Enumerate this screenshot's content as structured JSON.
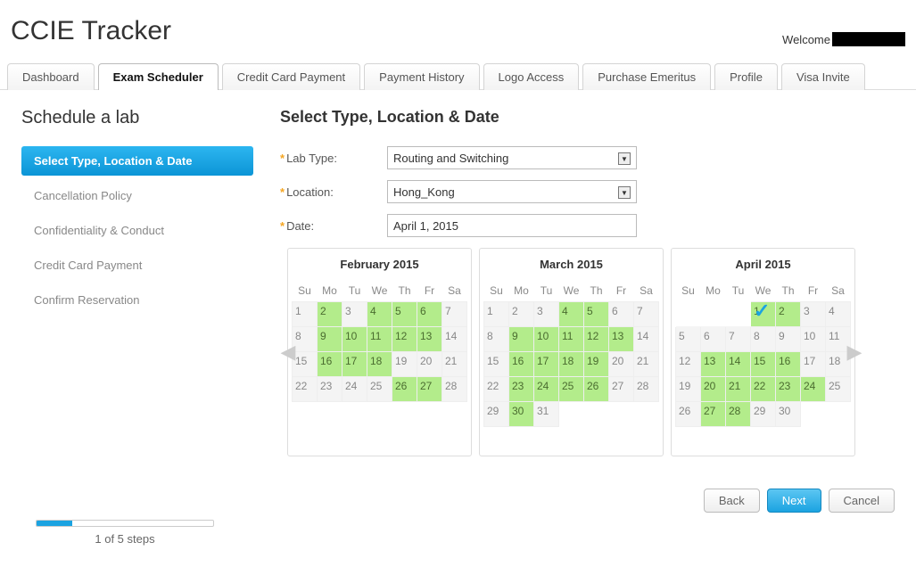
{
  "header": {
    "title": "CCIE Tracker",
    "welcome": "Welcome"
  },
  "tabs": [
    {
      "label": "Dashboard"
    },
    {
      "label": "Exam Scheduler"
    },
    {
      "label": "Credit Card Payment"
    },
    {
      "label": "Payment History"
    },
    {
      "label": "Logo Access"
    },
    {
      "label": "Purchase Emeritus"
    },
    {
      "label": "Profile"
    },
    {
      "label": "Visa Invite"
    }
  ],
  "activeTab": 1,
  "pageHeading": "Schedule a lab",
  "steps": [
    {
      "label": "Select Type, Location & Date"
    },
    {
      "label": "Cancellation Policy"
    },
    {
      "label": "Confidentiality & Conduct"
    },
    {
      "label": "Credit Card Payment"
    },
    {
      "label": "Confirm Reservation"
    }
  ],
  "activeStep": 0,
  "progress": {
    "percent": 20,
    "label": "1 of 5 steps"
  },
  "section": {
    "title": "Select Type, Location & Date"
  },
  "form": {
    "labTypeLabel": "Lab Type:",
    "labTypeValue": "Routing and Switching",
    "locationLabel": "Location:",
    "locationValue": "Hong_Kong",
    "dateLabel": "Date:",
    "dateValue": "April 1, 2015"
  },
  "dayHeaders": [
    "Su",
    "Mo",
    "Tu",
    "We",
    "Th",
    "Fr",
    "Sa"
  ],
  "months": [
    {
      "title": "February 2015",
      "weeks": [
        [
          {
            "d": 1
          },
          {
            "d": 2,
            "a": 1
          },
          {
            "d": 3
          },
          {
            "d": 4,
            "a": 1
          },
          {
            "d": 5,
            "a": 1
          },
          {
            "d": 6,
            "a": 1
          },
          {
            "d": 7
          }
        ],
        [
          {
            "d": 8
          },
          {
            "d": 9,
            "a": 1
          },
          {
            "d": 10,
            "a": 1
          },
          {
            "d": 11,
            "a": 1
          },
          {
            "d": 12,
            "a": 1
          },
          {
            "d": 13,
            "a": 1
          },
          {
            "d": 14
          }
        ],
        [
          {
            "d": 15
          },
          {
            "d": 16,
            "a": 1
          },
          {
            "d": 17,
            "a": 1
          },
          {
            "d": 18,
            "a": 1
          },
          {
            "d": 19
          },
          {
            "d": 20
          },
          {
            "d": 21
          }
        ],
        [
          {
            "d": 22
          },
          {
            "d": 23
          },
          {
            "d": 24
          },
          {
            "d": 25
          },
          {
            "d": 26,
            "a": 1
          },
          {
            "d": 27,
            "a": 1
          },
          {
            "d": 28
          }
        ],
        [
          {},
          {},
          {},
          {},
          {},
          {},
          {}
        ],
        [
          {},
          {},
          {},
          {},
          {},
          {},
          {}
        ]
      ]
    },
    {
      "title": "March 2015",
      "weeks": [
        [
          {
            "d": 1
          },
          {
            "d": 2
          },
          {
            "d": 3
          },
          {
            "d": 4,
            "a": 1
          },
          {
            "d": 5,
            "a": 1
          },
          {
            "d": 6
          },
          {
            "d": 7
          }
        ],
        [
          {
            "d": 8
          },
          {
            "d": 9,
            "a": 1
          },
          {
            "d": 10,
            "a": 1
          },
          {
            "d": 11,
            "a": 1
          },
          {
            "d": 12,
            "a": 1
          },
          {
            "d": 13,
            "a": 1
          },
          {
            "d": 14
          }
        ],
        [
          {
            "d": 15
          },
          {
            "d": 16,
            "a": 1
          },
          {
            "d": 17,
            "a": 1
          },
          {
            "d": 18,
            "a": 1
          },
          {
            "d": 19,
            "a": 1
          },
          {
            "d": 20
          },
          {
            "d": 21
          }
        ],
        [
          {
            "d": 22
          },
          {
            "d": 23,
            "a": 1
          },
          {
            "d": 24,
            "a": 1
          },
          {
            "d": 25,
            "a": 1
          },
          {
            "d": 26,
            "a": 1
          },
          {
            "d": 27
          },
          {
            "d": 28
          }
        ],
        [
          {
            "d": 29
          },
          {
            "d": 30,
            "a": 1
          },
          {
            "d": 31
          },
          {},
          {},
          {},
          {}
        ],
        [
          {},
          {},
          {},
          {},
          {},
          {},
          {}
        ]
      ]
    },
    {
      "title": "April 2015",
      "weeks": [
        [
          {},
          {},
          {},
          {
            "d": 1,
            "a": 1,
            "sel": 1
          },
          {
            "d": 2,
            "a": 1
          },
          {
            "d": 3
          },
          {
            "d": 4
          }
        ],
        [
          {
            "d": 5
          },
          {
            "d": 6
          },
          {
            "d": 7
          },
          {
            "d": 8
          },
          {
            "d": 9
          },
          {
            "d": 10
          },
          {
            "d": 11
          }
        ],
        [
          {
            "d": 12
          },
          {
            "d": 13,
            "a": 1
          },
          {
            "d": 14,
            "a": 1
          },
          {
            "d": 15,
            "a": 1
          },
          {
            "d": 16,
            "a": 1
          },
          {
            "d": 17
          },
          {
            "d": 18
          }
        ],
        [
          {
            "d": 19
          },
          {
            "d": 20,
            "a": 1
          },
          {
            "d": 21,
            "a": 1
          },
          {
            "d": 22,
            "a": 1
          },
          {
            "d": 23,
            "a": 1
          },
          {
            "d": 24,
            "a": 1
          },
          {
            "d": 25
          }
        ],
        [
          {
            "d": 26
          },
          {
            "d": 27,
            "a": 1
          },
          {
            "d": 28,
            "a": 1
          },
          {
            "d": 29
          },
          {
            "d": 30
          },
          {},
          {}
        ],
        [
          {},
          {},
          {},
          {},
          {},
          {},
          {}
        ]
      ]
    }
  ],
  "buttons": {
    "back": "Back",
    "next": "Next",
    "cancel": "Cancel"
  }
}
